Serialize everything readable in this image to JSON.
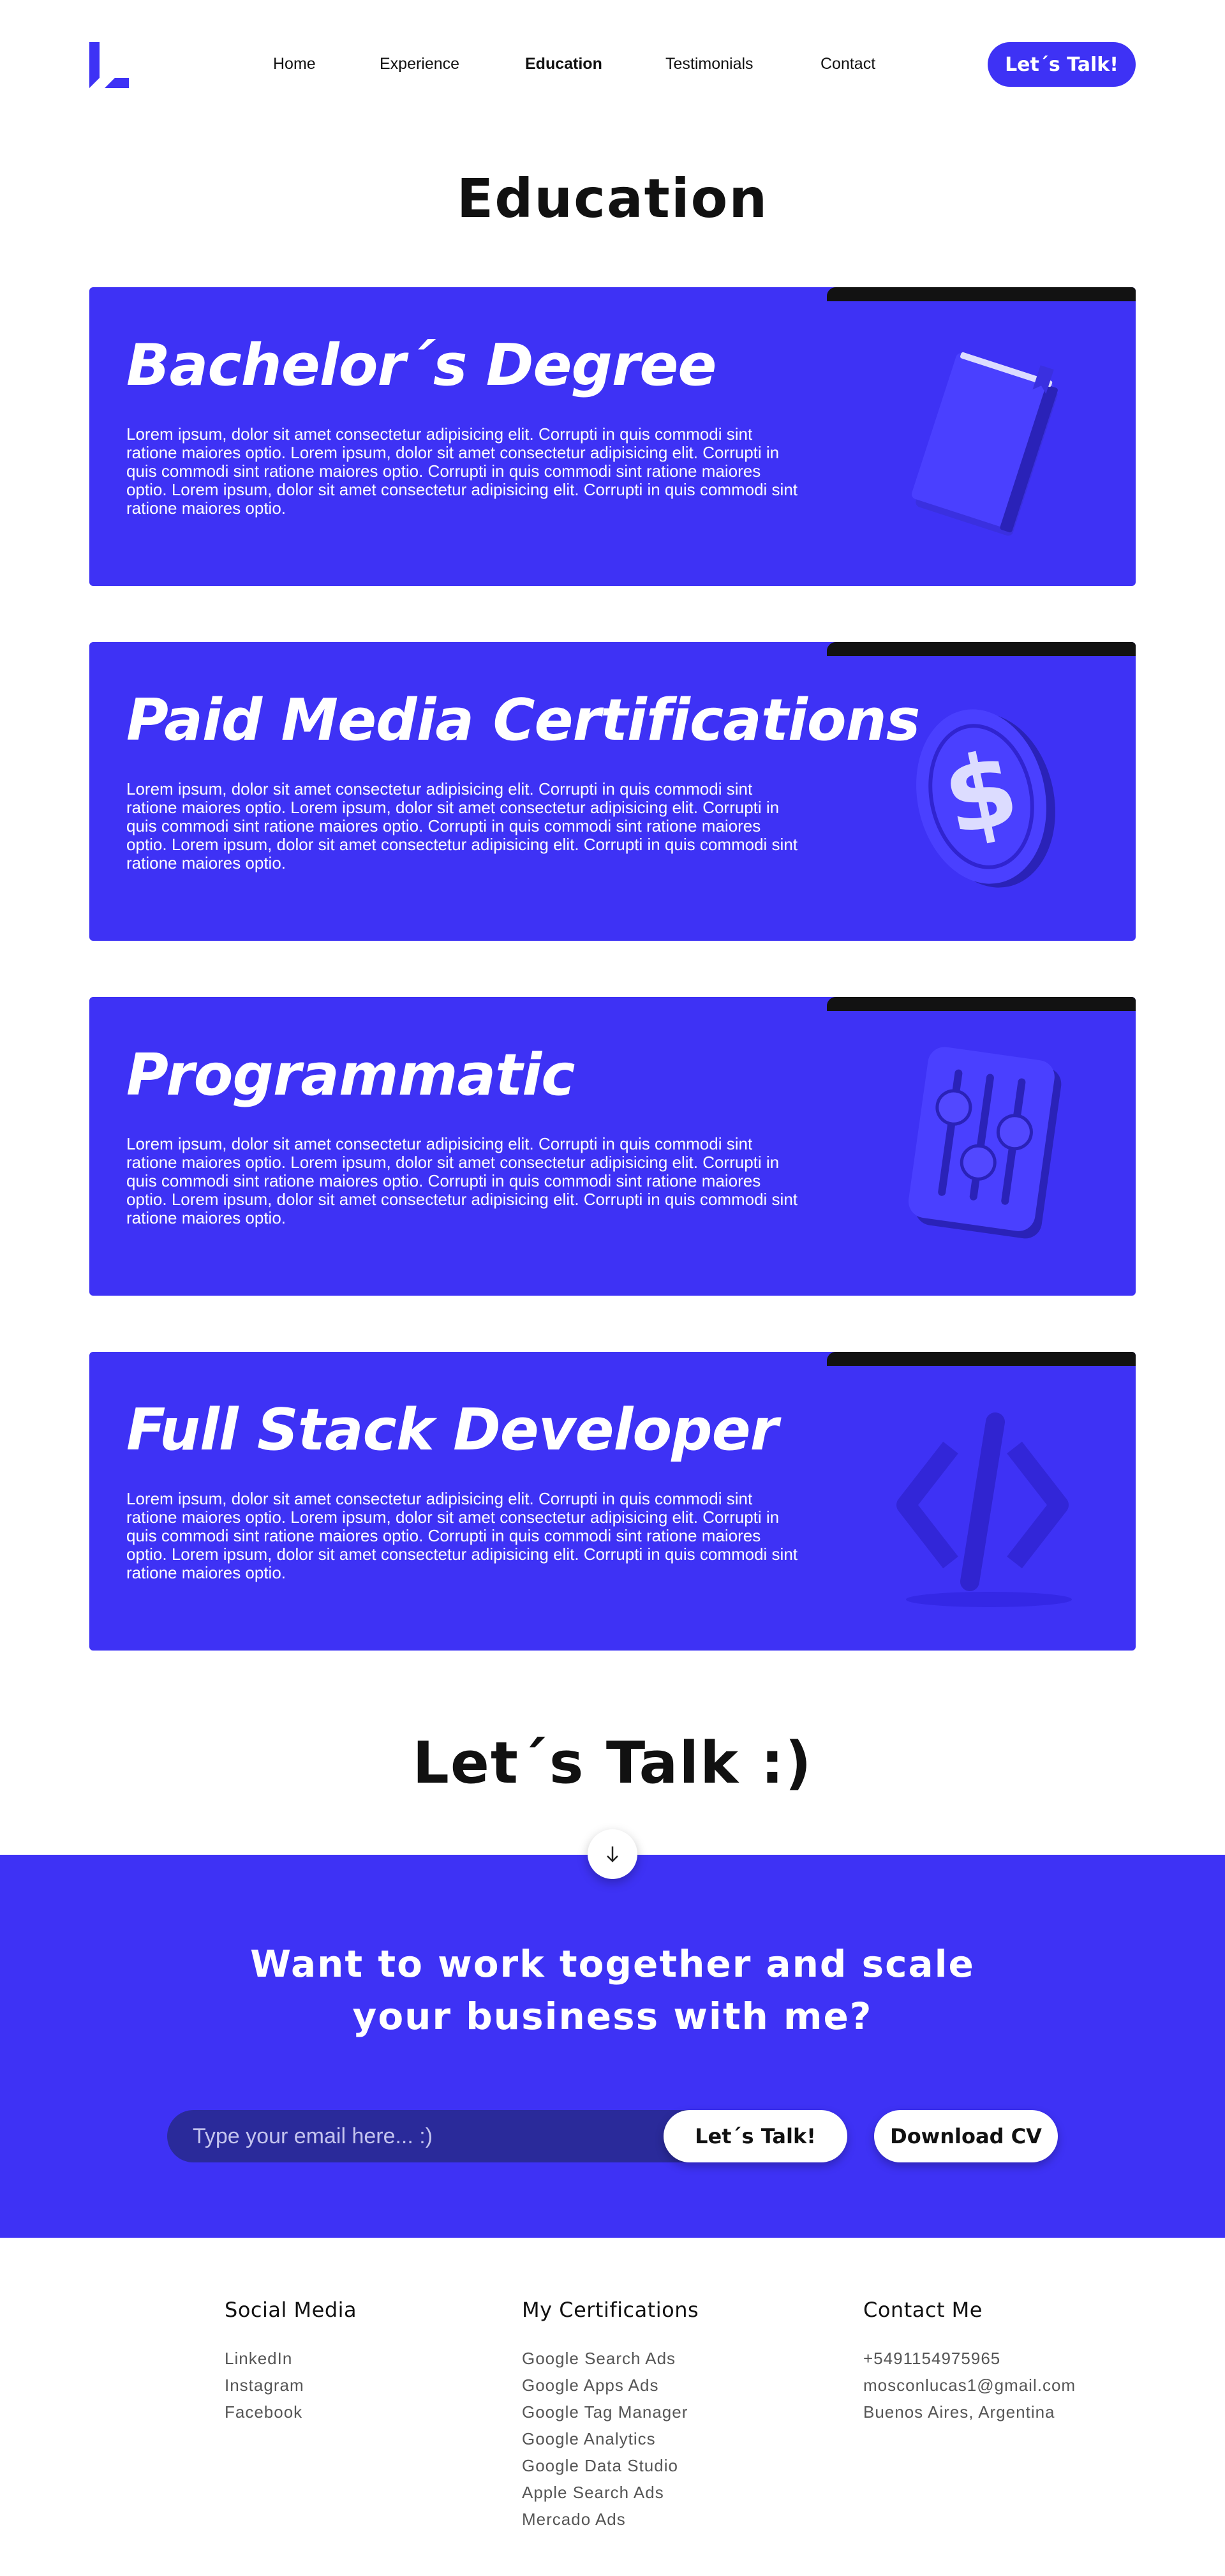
{
  "colors": {
    "accent": "#3e32f5",
    "dark": "#121212",
    "white": "#ffffff",
    "input_bg": "#2a2a9a"
  },
  "header": {
    "logo_icon": "l-logo-icon",
    "nav": [
      "Home",
      "Experience",
      "Education",
      "Testimonials",
      "Contact"
    ],
    "active_nav": "Education",
    "cta_label": "Let´s Talk!"
  },
  "education": {
    "title": "Education",
    "cards": [
      {
        "title": "Bachelor´s Degree",
        "text": "Lorem ipsum, dolor sit amet consectetur adipisicing elit. Corrupti in quis commodi sint ratione maiores optio. Lorem ipsum, dolor sit amet consectetur adipisicing elit. Corrupti in quis commodi sint ratione maiores optio. Corrupti in quis commodi sint ratione maiores optio. Lorem ipsum, dolor sit amet consectetur adipisicing elit. Corrupti in quis commodi sint ratione maiores optio.",
        "icon": "book-icon"
      },
      {
        "title": "Paid Media Certifications",
        "text": "Lorem ipsum, dolor sit amet consectetur adipisicing elit. Corrupti in quis commodi sint ratione maiores optio. Lorem ipsum, dolor sit amet consectetur adipisicing elit. Corrupti in quis commodi sint ratione maiores optio. Corrupti in quis commodi sint ratione maiores optio. Lorem ipsum, dolor sit amet consectetur adipisicing elit. Corrupti in quis commodi sint ratione maiores optio.",
        "icon": "dollar-coin-icon"
      },
      {
        "title": "Programmatic",
        "text": "Lorem ipsum, dolor sit amet consectetur adipisicing elit. Corrupti in quis commodi sint ratione maiores optio. Lorem ipsum, dolor sit amet consectetur adipisicing elit. Corrupti in quis commodi sint ratione maiores optio. Corrupti in quis commodi sint ratione maiores optio. Lorem ipsum, dolor sit amet consectetur adipisicing elit. Corrupti in quis commodi sint ratione maiores optio.",
        "icon": "mixer-sliders-icon"
      },
      {
        "title": "Full Stack Developer",
        "text": "Lorem ipsum, dolor sit amet consectetur adipisicing elit. Corrupti in quis commodi sint ratione maiores optio. Lorem ipsum, dolor sit amet consectetur adipisicing elit. Corrupti in quis commodi sint ratione maiores optio. Corrupti in quis commodi sint ratione maiores optio. Lorem ipsum, dolor sit amet consectetur adipisicing elit. Corrupti in quis commodi sint ratione maiores optio.",
        "icon": "code-brackets-icon"
      }
    ]
  },
  "talk": {
    "title": "Let´s Talk :)",
    "scroll_icon": "arrow-down-icon",
    "heading_line1": "Want to work together and scale",
    "heading_line2": "your business with me?",
    "email_placeholder": "Type your email here... :)",
    "submit_label": "Let´s Talk!",
    "cv_label": "Download CV"
  },
  "footer": {
    "social": {
      "title": "Social Media",
      "items": [
        "LinkedIn",
        "Instagram",
        "Facebook"
      ]
    },
    "certs": {
      "title": "My Certifications",
      "items": [
        "Google Search Ads",
        "Google Apps Ads",
        "Google Tag Manager",
        "Google Analytics",
        "Google Data Studio",
        "Apple Search Ads",
        "Mercado Ads"
      ]
    },
    "contact": {
      "title": "Contact Me",
      "items": [
        "+5491154975965",
        "mosconlucas1@gmail.com",
        "Buenos Aires, Argentina"
      ]
    }
  }
}
